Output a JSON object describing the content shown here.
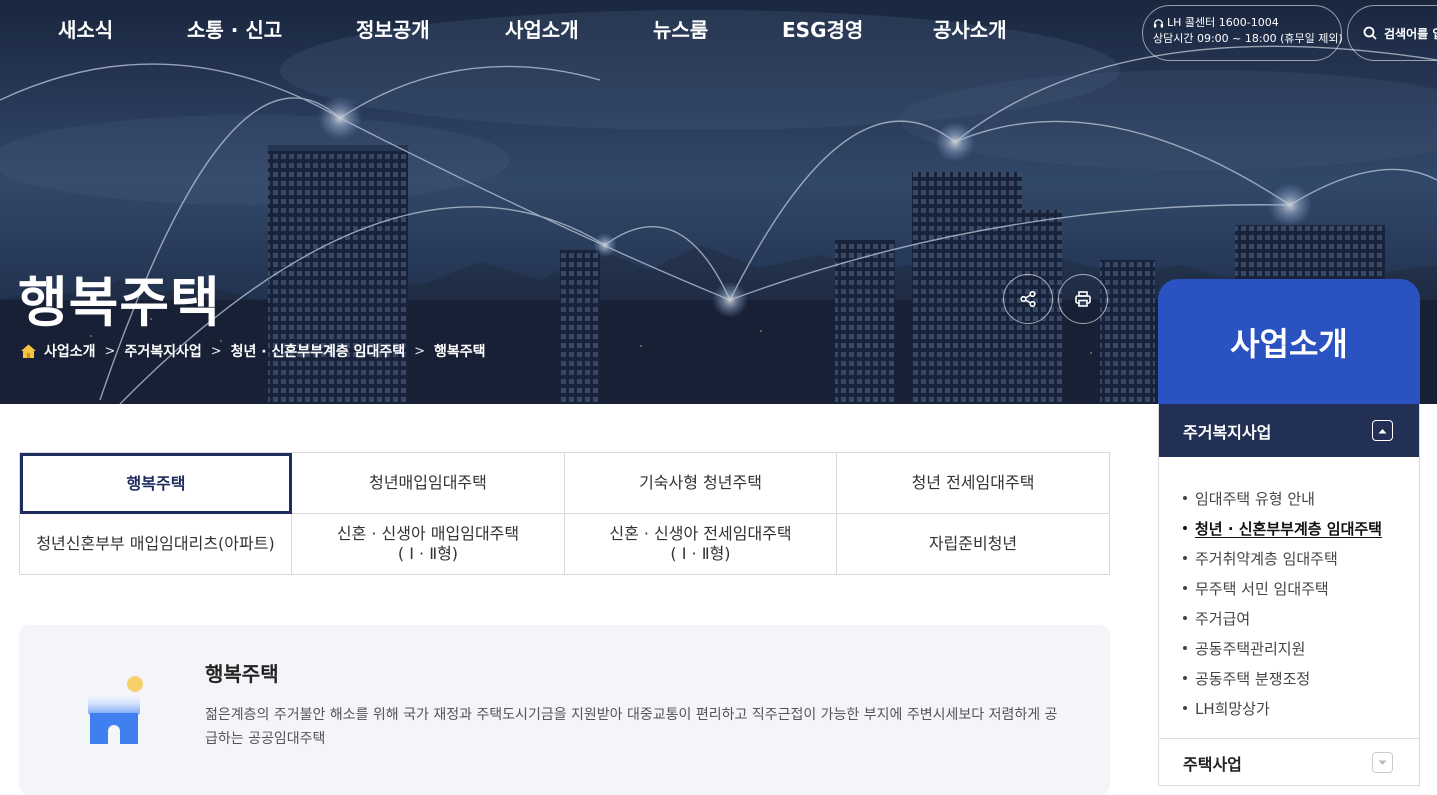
{
  "header": {
    "nav": [
      "새소식",
      "소통 · 신고",
      "정보공개",
      "사업소개",
      "뉴스룸",
      "ESG경영",
      "공사소개"
    ],
    "call_center": {
      "line1": "LH 콜센터 1600-1004",
      "line2": "상담시간 09:00 ~ 18:00 (휴무일 제외)"
    },
    "search_label": "검색어를 입력"
  },
  "hero": {
    "title": "행복주택",
    "breadcrumb": [
      "사업소개",
      "주거복지사업",
      "청년 · 신혼부부계층 임대주택",
      "행복주택"
    ],
    "share_icon": "share-icon",
    "print_icon": "print-icon"
  },
  "side": {
    "title": "사업소개",
    "section": "주거복지사업",
    "items": [
      {
        "label": "임대주택 유형 안내",
        "active": false
      },
      {
        "label": "청년 · 신혼부부계층 임대주택",
        "active": true
      },
      {
        "label": "주거취약계층 임대주택",
        "active": false
      },
      {
        "label": "무주택 서민 임대주택",
        "active": false
      },
      {
        "label": "주거급여",
        "active": false
      },
      {
        "label": "공동주택관리지원",
        "active": false
      },
      {
        "label": "공동주택 분쟁조정",
        "active": false
      },
      {
        "label": "LH희망상가",
        "active": false
      }
    ],
    "section2": "주택사업"
  },
  "tabs": [
    {
      "line1": "행복주택",
      "line2": "",
      "active": true
    },
    {
      "line1": "청년매입임대주택",
      "line2": "",
      "active": false
    },
    {
      "line1": "기숙사형 청년주택",
      "line2": "",
      "active": false
    },
    {
      "line1": "청년 전세임대주택",
      "line2": "",
      "active": false
    },
    {
      "line1": "청년신혼부부 매입임대리츠(아파트)",
      "line2": "",
      "active": false
    },
    {
      "line1": "신혼 · 신생아 매입임대주택",
      "line2": "( Ⅰ · Ⅱ형)",
      "active": false
    },
    {
      "line1": "신혼 · 신생아 전세임대주택",
      "line2": "( Ⅰ · Ⅱ형)",
      "active": false
    },
    {
      "line1": "자립준비청년",
      "line2": "",
      "active": false
    }
  ],
  "info": {
    "title": "행복주택",
    "description": "젊은계층의 주거불안 해소를 위해 국가 재정과 주택도시기금을 지원받아 대중교통이 편리하고 직주근접이 가능한 부지에 주변시세보다 저렴하게 공급하는 공공임대주택",
    "icon": "house-icon"
  },
  "colors": {
    "primary_navy": "#1e2c5e",
    "side_blue": "#2a52c0",
    "section_navy": "#233055"
  }
}
